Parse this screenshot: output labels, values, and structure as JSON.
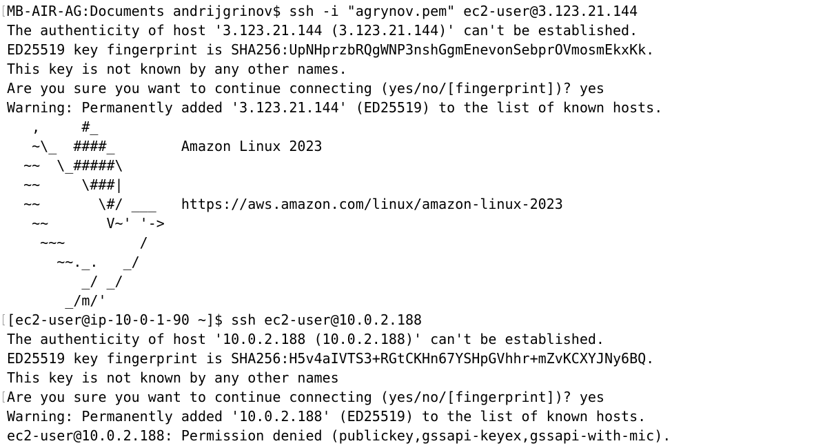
{
  "terminal": {
    "lines": [
      "MB-AIR-AG:Documents andrijgrinov$ ssh -i \"agrynov.pem\" ec2-user@3.123.21.144",
      "The authenticity of host '3.123.21.144 (3.123.21.144)' can't be established.",
      "ED25519 key fingerprint is SHA256:UpNHprzbRQgWNP3nshGgmEnevonSebprOVmosmEkxKk.",
      "This key is not known by any other names.",
      "Are you sure you want to continue connecting (yes/no/[fingerprint])? yes",
      "Warning: Permanently added '3.123.21.144' (ED25519) to the list of known hosts.",
      "   ,     #_",
      "   ~\\_  ####_        Amazon Linux 2023",
      "  ~~  \\_#####\\",
      "  ~~     \\###|",
      "  ~~       \\#/ ___   https://aws.amazon.com/linux/amazon-linux-2023",
      "   ~~       V~' '->",
      "    ~~~         /",
      "      ~~._.   _/",
      "         _/ _/",
      "       _/m/'",
      "[ec2-user@ip-10-0-1-90 ~]$ ssh ec2-user@10.0.2.188",
      "The authenticity of host '10.0.2.188 (10.0.2.188)' can't be established.",
      "ED25519 key fingerprint is SHA256:H5v4aIVTS3+RGtCKHn67YSHpGVhhr+mZvKCXYJNy6BQ.",
      "This key is not known by any other names",
      "Are you sure you want to continue connecting (yes/no/[fingerprint])? yes",
      "Warning: Permanently added '10.0.2.188' (ED25519) to the list of known hosts.",
      "ec2-user@10.0.2.188: Permission denied (publickey,gssapi-keyex,gssapi-with-mic)."
    ]
  }
}
